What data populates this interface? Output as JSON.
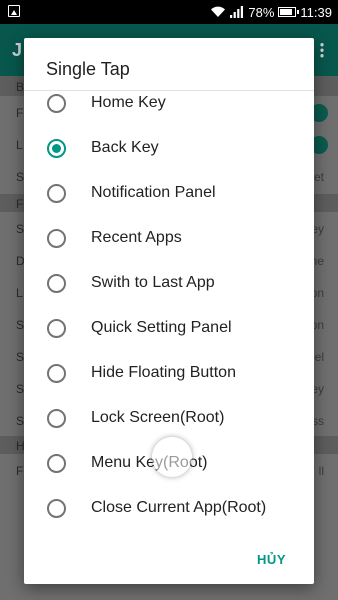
{
  "status_bar": {
    "battery": "78%",
    "time": "11:39"
  },
  "background_app": {
    "title": "J",
    "rows": [
      {
        "left": "B",
        "right": ""
      },
      {
        "left": "F",
        "right": ""
      },
      {
        "left": "L",
        "right": ""
      },
      {
        "left": "S",
        "right": "et"
      },
      {
        "left": "F",
        "right": ""
      },
      {
        "left": "S",
        "right": "ey"
      },
      {
        "left": "D",
        "right": "ne"
      },
      {
        "left": "L",
        "right": "on"
      },
      {
        "left": "S",
        "right": "on"
      },
      {
        "left": "S",
        "right": "el"
      },
      {
        "left": "S",
        "right": "ey"
      },
      {
        "left": "S",
        "right": "ss"
      },
      {
        "left": "H",
        "right": ""
      },
      {
        "left": "F",
        "right": "ll"
      }
    ]
  },
  "dialog": {
    "title": "Single Tap",
    "options": [
      {
        "label": "Home Key",
        "selected": false
      },
      {
        "label": "Back Key",
        "selected": true
      },
      {
        "label": "Notification Panel",
        "selected": false
      },
      {
        "label": "Recent Apps",
        "selected": false
      },
      {
        "label": "Swith to Last App",
        "selected": false
      },
      {
        "label": "Quick Setting Panel",
        "selected": false
      },
      {
        "label": "Hide Floating Button",
        "selected": false
      },
      {
        "label": "Lock Screen(Root)",
        "selected": false
      },
      {
        "label": "Menu Key(Root)",
        "selected": false
      },
      {
        "label": "Close Current App(Root)",
        "selected": false
      }
    ],
    "cancel_label": "HỦY"
  },
  "colors": {
    "accent": "#009688",
    "toolbar": "#07574d"
  }
}
